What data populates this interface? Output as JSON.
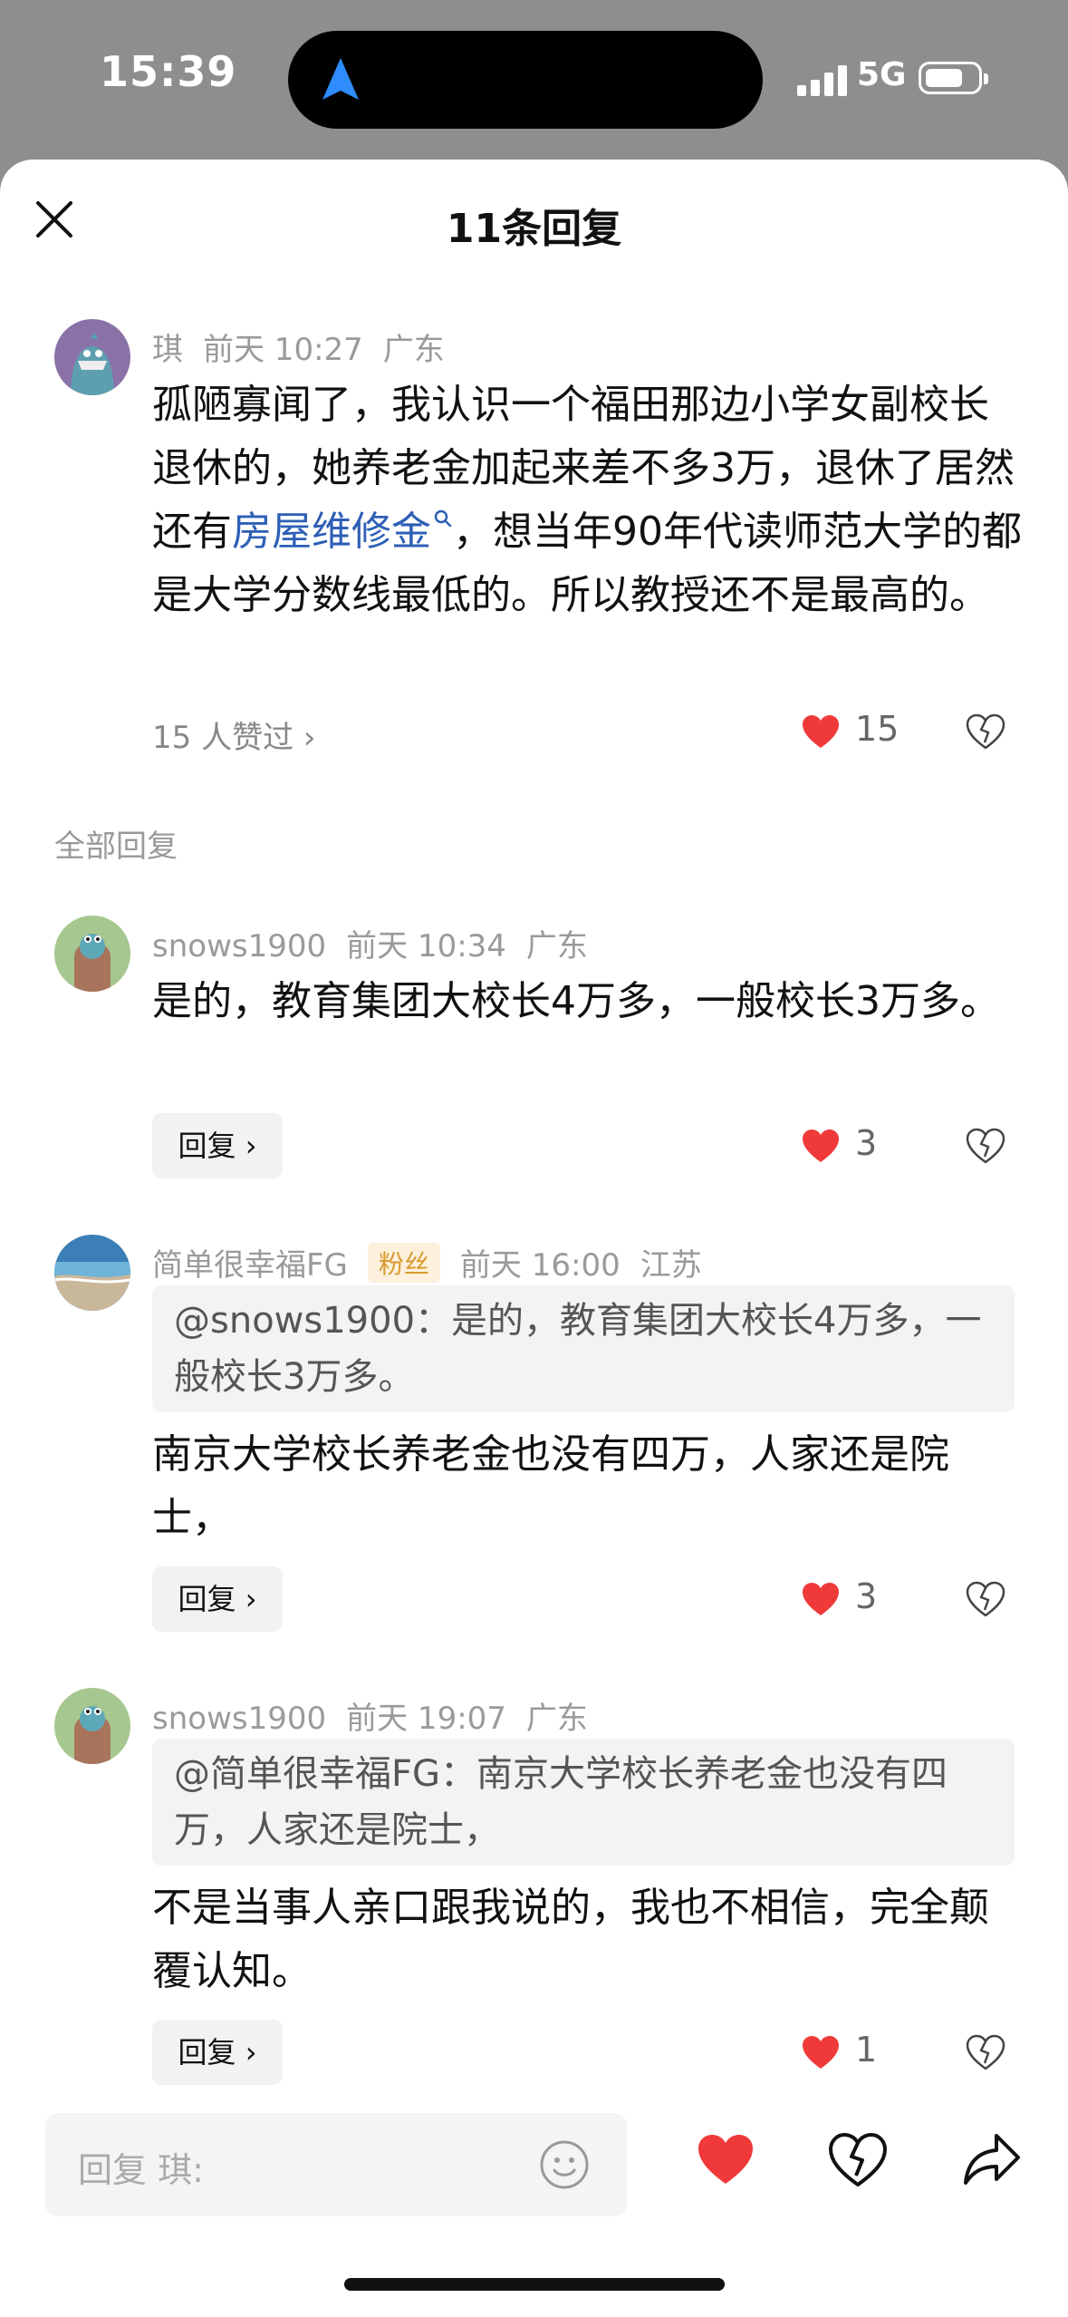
{
  "status_bar": {
    "time": "15:39",
    "network": "5G"
  },
  "sheet": {
    "title": "11条回复"
  },
  "main_comment": {
    "username": "琪",
    "time": "前天 10:27",
    "location": "广东",
    "text_before_link": "孤陋寡闻了，我认识一个福田那边小学女副校长退休的，她养老金加起来差不多3万，退休了居然还有",
    "link_text": "房屋维修金",
    "text_after_link": "，想当年90年代读师范大学的都是大学分数线最低的。所以教授还不是最高的。",
    "liked_by": "15 人赞过",
    "like_count": "15"
  },
  "section_label": "全部回复",
  "replies": [
    {
      "username": "snows1900",
      "time": "前天 10:34",
      "location": "广东",
      "text": "是的，教育集团大校长4万多，一般校长3万多。",
      "reply_label": "回复",
      "like_count": "3"
    },
    {
      "username": "简单很幸福FG",
      "badge": "粉丝",
      "time": "前天 16:00",
      "location": "江苏",
      "quote": "@snows1900：是的，教育集团大校长4万多，一般校长3万多。",
      "text": "南京大学校长养老金也没有四万，人家还是院士，",
      "reply_label": "回复",
      "like_count": "3"
    },
    {
      "username": "snows1900",
      "time": "前天 19:07",
      "location": "广东",
      "quote": "@简单很幸福FG：南京大学校长养老金也没有四万，人家还是院士，",
      "text": "不是当事人亲口跟我说的，我也不相信，完全颠覆认知。",
      "reply_label": "回复",
      "like_count": "1"
    }
  ],
  "bottom_bar": {
    "reply_placeholder": "回复 琪:"
  },
  "colors": {
    "like_red": "#f03a3a",
    "link_blue": "#2d5fb6",
    "badge_orange": "#d99a2f"
  }
}
